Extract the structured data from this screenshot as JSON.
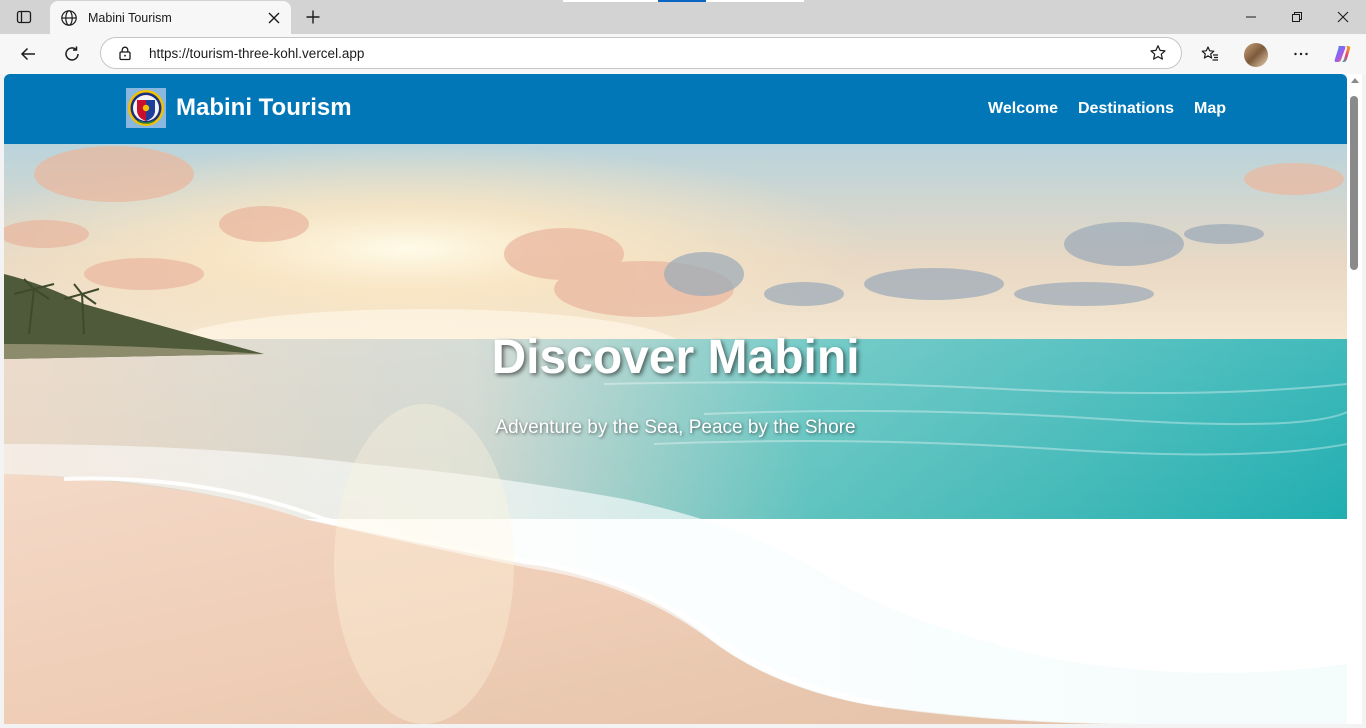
{
  "browser": {
    "tab_title": "Mabini Tourism",
    "url": "https://tourism-three-kohl.vercel.app",
    "icons": [
      "tab-actions-icon",
      "globe-icon",
      "close-icon",
      "plus-icon",
      "minimize-icon",
      "restore-icon",
      "close-window-icon",
      "back-icon",
      "refresh-icon",
      "lock-icon",
      "star-icon",
      "favorites-icon",
      "more-icon",
      "copilot-icon"
    ]
  },
  "site": {
    "brand": "Mabini Tourism",
    "nav": {
      "welcome": "Welcome",
      "destinations": "Destinations",
      "map": "Map"
    },
    "hero": {
      "title": "Discover Mabini",
      "subtitle": "Adventure by the Sea, Peace by the Shore"
    }
  },
  "colors": {
    "nav_bg": "#0277b8",
    "tabbar_bg": "#d3d3d3",
    "toolbar_bg": "#f7f7f7"
  }
}
